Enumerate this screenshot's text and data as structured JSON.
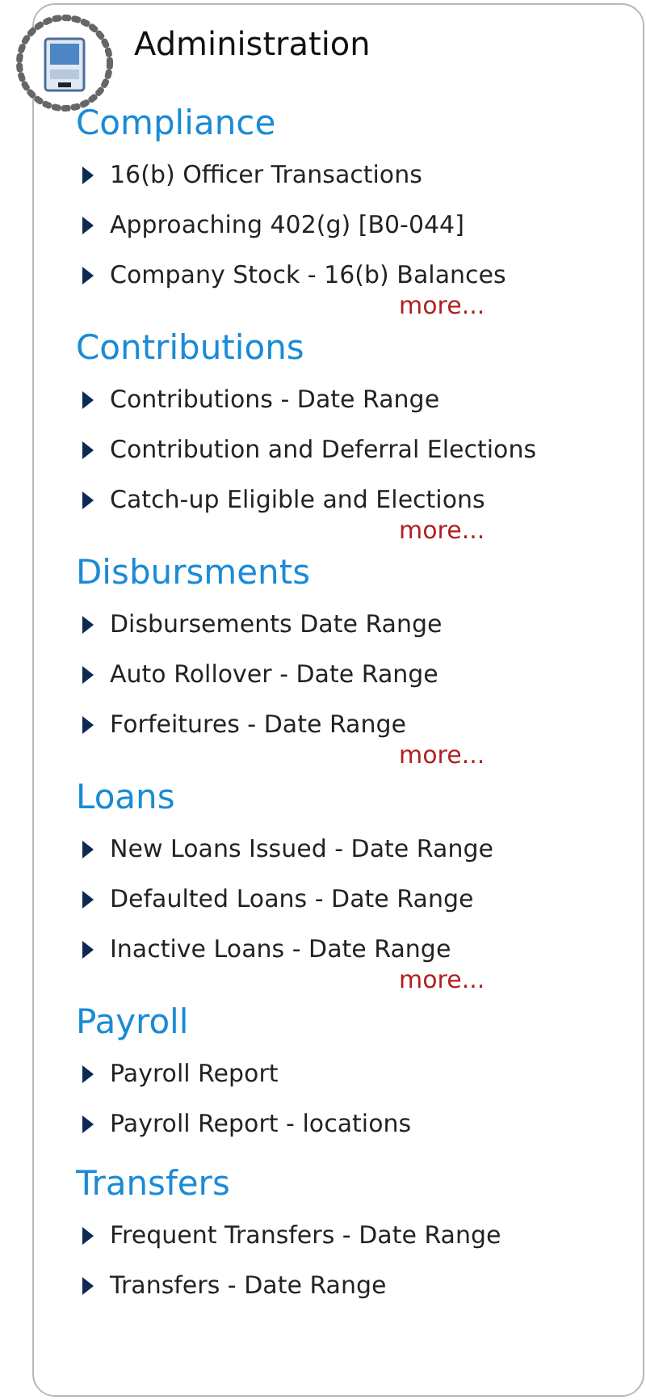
{
  "header": {
    "title": "Administration"
  },
  "sections": [
    {
      "title": "Compliance",
      "items": [
        "16(b) Officer Transactions",
        "Approaching 402(g) [B0-044]",
        "Company Stock - 16(b) Balances"
      ],
      "more": "more..."
    },
    {
      "title": "Contributions",
      "items": [
        "Contributions - Date Range",
        "Contribution and Deferral Elections",
        "Catch-up Eligible and Elections"
      ],
      "more": "more..."
    },
    {
      "title": "Disbursments",
      "items": [
        "Disbursements Date Range",
        "Auto Rollover - Date Range",
        "Forfeitures - Date Range"
      ],
      "more": "more..."
    },
    {
      "title": "Loans",
      "items": [
        "New Loans Issued - Date Range",
        "Defaulted Loans - Date Range",
        "Inactive Loans - Date Range"
      ],
      "more": "more..."
    },
    {
      "title": "Payroll",
      "items": [
        "Payroll Report",
        "Payroll Report - locations"
      ]
    },
    {
      "title": "Transfers",
      "items": [
        "Frequent Transfers - Date Range",
        "Transfers - Date Range"
      ]
    }
  ]
}
